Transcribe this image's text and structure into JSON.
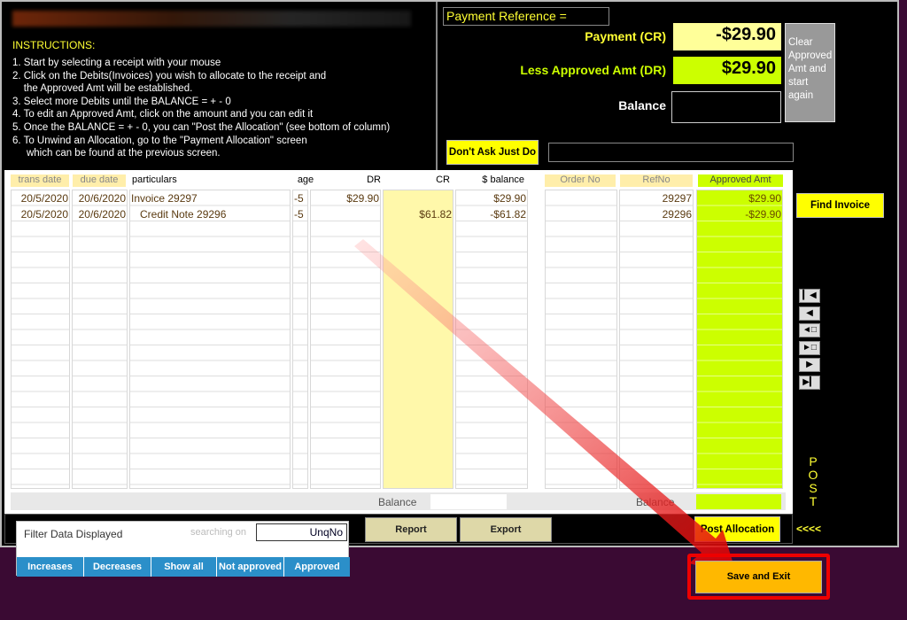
{
  "instructions": {
    "heading": "INSTRUCTIONS:",
    "lines": [
      "1. Start by selecting a receipt with your mouse",
      "2. Click on the Debits(Invoices) you wish to allocate to the receipt and",
      "    the Approved Amt will be established.",
      "3. Select more Debits until the BALANCE = + - 0",
      "4. To edit an Approved Amt, click on the amount and you can edit it",
      "5. Once the BALANCE = + - 0, you can \"Post the Allocation\" (see bottom of column)",
      "6. To Unwind an Allocation, go to the \"Payment Allocation\" screen",
      "     which can be found at the previous screen."
    ]
  },
  "payment": {
    "reference_label": "Payment Reference =",
    "payment_label": "Payment (CR)",
    "payment_value": "-$29.90",
    "approved_label": "Less Approved Amt (DR)",
    "approved_value": "$29.90",
    "balance_label": "Balance",
    "balance_value": "",
    "clear_button": "Clear Approved Amt and start again",
    "dont_ask_button": "Don't Ask Just Do",
    "find_invoice_button": "Find Invoice"
  },
  "table": {
    "headers": {
      "trans_date": "trans date",
      "due_date": "due date",
      "particulars": "particulars",
      "age": "age",
      "dr": "DR",
      "cr": "CR",
      "balance": "$ balance",
      "order_no": "Order No",
      "ref_no": "RefNo",
      "approved": "Approved Amt"
    },
    "rows": [
      {
        "trans_date": "20/5/2020",
        "due_date": "20/6/2020",
        "particulars": "Invoice 29297",
        "age": "-5",
        "dr": "$29.90",
        "cr": "",
        "balance": "$29.90",
        "order_no": "",
        "ref_no": "29297",
        "approved": "$29.90"
      },
      {
        "trans_date": "20/5/2020",
        "due_date": "20/6/2020",
        "particulars": "   Credit Note 29296",
        "age": "-5",
        "dr": "",
        "cr": "$61.82",
        "balance": "-$61.82",
        "order_no": "",
        "ref_no": "29296",
        "approved": "-$29.90"
      }
    ],
    "balance_label_left": "Balance",
    "balance_label_right": "Balance"
  },
  "filter": {
    "title": "Filter Data Displayed",
    "search_label": "searching on",
    "search_value": "UnqNo",
    "buttons": [
      "Increases",
      "Decreases",
      "Show all",
      "Not approved",
      "Approved"
    ]
  },
  "actions": {
    "report": "Report",
    "export": "Export",
    "post_allocation": "Post Allocation",
    "save_exit": "Save and Exit"
  },
  "post_side": {
    "letters": "POST",
    "arrows": "<<<<"
  }
}
